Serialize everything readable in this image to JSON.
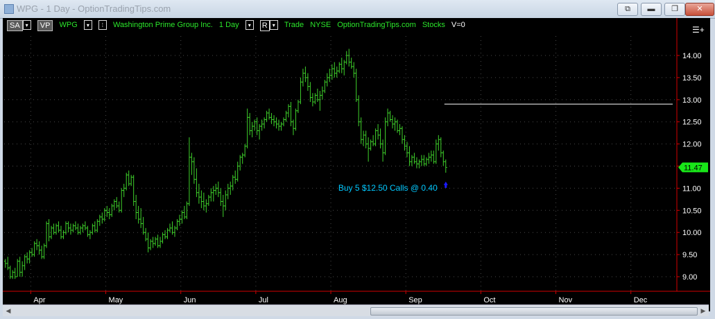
{
  "window": {
    "title": "WPG - 1 Day - OptionTradingTips.com",
    "buttons": {
      "pin": "⧉",
      "minimize": "▬",
      "restore": "❐",
      "close": "✕"
    }
  },
  "toolbar": {
    "sa": "SA",
    "vp": "VP",
    "symbol": "WPG",
    "company": "Washington Prime Group Inc.",
    "period": "1 Day",
    "r_box": "R",
    "type": "Trade",
    "exchange": "NYSE",
    "source": "OptionTradingTips.com",
    "asset": "Stocks",
    "volume": "V=0",
    "menu": "☰+"
  },
  "colors": {
    "bar": "#3fd22b",
    "axis": "#d40000",
    "price_tag": "#19e619",
    "annotation": "#00c8ff",
    "marker": "#1a1aff",
    "level": "#ffffff"
  },
  "chart_data": {
    "type": "bar",
    "subtype": "ohlc",
    "title": "",
    "xlabel": "",
    "ylabel": "",
    "ylim": [
      8.75,
      14.25
    ],
    "yticks": [
      "14.00",
      "13.50",
      "13.00",
      "12.50",
      "12.00",
      "11.50",
      "11.00",
      "10.50",
      "10.00",
      "9.50",
      "9.00"
    ],
    "month_labels": [
      "Apr",
      "May",
      "Jun",
      "Jul",
      "Aug",
      "Sep",
      "Oct",
      "Nov",
      "Dec"
    ],
    "month_start_index": [
      11,
      42,
      73,
      104,
      135,
      166,
      197,
      228,
      259
    ],
    "total_slots": 278,
    "last_price": "11.47",
    "level_line": 12.9,
    "annotation": "Buy 5 $12.50 Calls @ 0.40",
    "bars": [
      [
        9.35,
        9.4,
        9.2,
        9.3
      ],
      [
        9.3,
        9.45,
        9.15,
        9.2
      ],
      [
        9.2,
        9.25,
        8.95,
        9.0
      ],
      [
        9.0,
        9.15,
        8.95,
        9.1
      ],
      [
        9.1,
        9.2,
        8.95,
        9.0
      ],
      [
        9.0,
        9.4,
        9.0,
        9.35
      ],
      [
        9.35,
        9.45,
        9.0,
        9.1
      ],
      [
        9.1,
        9.35,
        9.0,
        9.25
      ],
      [
        9.25,
        9.5,
        9.15,
        9.45
      ],
      [
        9.45,
        9.55,
        9.3,
        9.4
      ],
      [
        9.4,
        9.6,
        9.3,
        9.55
      ],
      [
        9.55,
        9.65,
        9.45,
        9.5
      ],
      [
        9.5,
        9.8,
        9.45,
        9.75
      ],
      [
        9.75,
        9.85,
        9.6,
        9.7
      ],
      [
        9.7,
        9.8,
        9.5,
        9.6
      ],
      [
        9.6,
        9.7,
        9.4,
        9.45
      ],
      [
        9.45,
        9.75,
        9.4,
        9.7
      ],
      [
        9.7,
        10.25,
        9.65,
        10.2
      ],
      [
        10.2,
        10.3,
        9.8,
        9.9
      ],
      [
        9.9,
        10.15,
        9.85,
        10.1
      ],
      [
        10.1,
        10.2,
        9.95,
        10.0
      ],
      [
        10.0,
        10.2,
        9.95,
        10.15
      ],
      [
        10.15,
        10.25,
        10.0,
        10.05
      ],
      [
        10.05,
        10.15,
        9.85,
        9.9
      ],
      [
        9.9,
        10.05,
        9.85,
        10.0
      ],
      [
        10.0,
        10.25,
        9.95,
        10.2
      ],
      [
        10.2,
        10.25,
        10.0,
        10.1
      ],
      [
        10.1,
        10.2,
        9.95,
        10.05
      ],
      [
        10.05,
        10.2,
        10.0,
        10.15
      ],
      [
        10.15,
        10.25,
        10.05,
        10.1
      ],
      [
        10.1,
        10.2,
        9.95,
        10.0
      ],
      [
        10.0,
        10.15,
        9.95,
        10.1
      ],
      [
        10.1,
        10.2,
        10.0,
        10.15
      ],
      [
        10.15,
        10.25,
        10.05,
        10.1
      ],
      [
        10.1,
        10.15,
        9.9,
        9.95
      ],
      [
        9.95,
        10.05,
        9.85,
        10.0
      ],
      [
        10.0,
        10.2,
        9.95,
        10.15
      ],
      [
        10.15,
        10.25,
        10.0,
        10.05
      ],
      [
        10.05,
        10.3,
        10.0,
        10.25
      ],
      [
        10.25,
        10.4,
        10.15,
        10.35
      ],
      [
        10.35,
        10.45,
        10.2,
        10.3
      ],
      [
        10.3,
        10.55,
        10.25,
        10.5
      ],
      [
        10.5,
        10.6,
        10.35,
        10.45
      ],
      [
        10.45,
        10.55,
        10.3,
        10.4
      ],
      [
        10.4,
        10.65,
        10.35,
        10.6
      ],
      [
        10.6,
        10.75,
        10.5,
        10.7
      ],
      [
        10.7,
        10.8,
        10.55,
        10.6
      ],
      [
        10.6,
        10.7,
        10.45,
        10.5
      ],
      [
        10.5,
        11.0,
        10.45,
        10.95
      ],
      [
        10.95,
        11.1,
        10.8,
        11.0
      ],
      [
        11.0,
        11.35,
        10.95,
        11.3
      ],
      [
        11.3,
        11.4,
        11.05,
        11.1
      ],
      [
        11.1,
        11.3,
        11.05,
        11.25
      ],
      [
        11.25,
        11.3,
        10.6,
        10.7
      ],
      [
        10.7,
        10.85,
        10.3,
        10.45
      ],
      [
        10.45,
        10.6,
        10.2,
        10.3
      ],
      [
        10.3,
        10.55,
        10.1,
        10.2
      ],
      [
        10.2,
        10.35,
        9.95,
        10.0
      ],
      [
        10.0,
        10.1,
        9.8,
        9.85
      ],
      [
        9.85,
        10.0,
        9.55,
        9.65
      ],
      [
        9.65,
        9.85,
        9.6,
        9.8
      ],
      [
        9.8,
        9.9,
        9.65,
        9.75
      ],
      [
        9.75,
        9.9,
        9.7,
        9.85
      ],
      [
        9.85,
        9.95,
        9.65,
        9.7
      ],
      [
        9.7,
        9.9,
        9.65,
        9.8
      ],
      [
        9.8,
        10.0,
        9.75,
        9.95
      ],
      [
        9.95,
        10.05,
        9.85,
        9.9
      ],
      [
        9.9,
        10.1,
        9.85,
        10.05
      ],
      [
        10.05,
        10.2,
        10.0,
        10.1
      ],
      [
        10.1,
        10.25,
        9.95,
        10.0
      ],
      [
        10.0,
        10.15,
        9.9,
        10.1
      ],
      [
        10.1,
        10.3,
        10.05,
        10.25
      ],
      [
        10.25,
        10.4,
        10.15,
        10.3
      ],
      [
        10.3,
        10.5,
        10.2,
        10.45
      ],
      [
        10.45,
        10.6,
        10.3,
        10.35
      ],
      [
        10.35,
        10.7,
        10.3,
        10.65
      ],
      [
        10.65,
        12.15,
        10.6,
        11.7
      ],
      [
        11.7,
        11.8,
        11.3,
        11.6
      ],
      [
        11.6,
        11.7,
        11.1,
        11.2
      ],
      [
        11.2,
        11.45,
        10.8,
        10.9
      ],
      [
        10.9,
        11.1,
        10.65,
        10.8
      ],
      [
        10.8,
        10.95,
        10.55,
        10.7
      ],
      [
        10.7,
        10.9,
        10.5,
        10.6
      ],
      [
        10.6,
        10.75,
        10.45,
        10.65
      ],
      [
        10.65,
        10.85,
        10.6,
        10.8
      ],
      [
        10.8,
        11.0,
        10.7,
        10.9
      ],
      [
        10.9,
        11.05,
        10.7,
        10.95
      ],
      [
        10.95,
        11.1,
        10.85,
        11.0
      ],
      [
        11.0,
        11.15,
        10.8,
        10.9
      ],
      [
        10.9,
        11.0,
        10.6,
        10.7
      ],
      [
        10.7,
        10.85,
        10.35,
        10.6
      ],
      [
        10.6,
        10.95,
        10.5,
        10.85
      ],
      [
        10.85,
        11.1,
        10.75,
        11.0
      ],
      [
        11.0,
        11.15,
        10.85,
        11.05
      ],
      [
        11.05,
        11.3,
        10.95,
        11.25
      ],
      [
        11.25,
        11.4,
        11.1,
        11.2
      ],
      [
        11.2,
        11.6,
        11.15,
        11.5
      ],
      [
        11.5,
        11.75,
        11.4,
        11.7
      ],
      [
        11.7,
        11.8,
        11.55,
        11.75
      ],
      [
        11.75,
        12.0,
        11.7,
        11.95
      ],
      [
        11.95,
        12.8,
        11.9,
        12.6
      ],
      [
        12.6,
        12.7,
        12.2,
        12.3
      ],
      [
        12.3,
        12.5,
        12.15,
        12.4
      ],
      [
        12.4,
        12.55,
        12.3,
        12.5
      ],
      [
        12.5,
        12.6,
        12.2,
        12.3
      ],
      [
        12.3,
        12.45,
        12.1,
        12.4
      ],
      [
        12.4,
        12.55,
        12.3,
        12.45
      ],
      [
        12.45,
        12.6,
        12.35,
        12.55
      ],
      [
        12.55,
        12.75,
        12.5,
        12.7
      ],
      [
        12.7,
        12.8,
        12.55,
        12.6
      ],
      [
        12.6,
        12.7,
        12.45,
        12.55
      ],
      [
        12.55,
        12.65,
        12.4,
        12.5
      ],
      [
        12.5,
        12.6,
        12.35,
        12.45
      ],
      [
        12.45,
        12.55,
        12.3,
        12.4
      ],
      [
        12.4,
        12.5,
        12.3,
        12.45
      ],
      [
        12.45,
        12.6,
        12.4,
        12.55
      ],
      [
        12.55,
        12.75,
        12.5,
        12.7
      ],
      [
        12.7,
        12.9,
        12.6,
        12.85
      ],
      [
        12.85,
        12.95,
        12.4,
        12.5
      ],
      [
        12.5,
        12.55,
        12.2,
        12.35
      ],
      [
        12.35,
        12.8,
        12.3,
        12.75
      ],
      [
        12.75,
        13.0,
        12.7,
        12.95
      ],
      [
        12.95,
        13.5,
        12.9,
        13.4
      ],
      [
        13.4,
        13.7,
        13.3,
        13.6
      ],
      [
        13.6,
        13.75,
        13.4,
        13.5
      ],
      [
        13.5,
        13.6,
        13.2,
        13.3
      ],
      [
        13.3,
        13.4,
        12.95,
        13.05
      ],
      [
        13.05,
        13.15,
        12.85,
        12.95
      ],
      [
        12.95,
        13.15,
        12.9,
        13.1
      ],
      [
        13.1,
        13.25,
        12.95,
        13.0
      ],
      [
        13.0,
        13.2,
        12.75,
        13.1
      ],
      [
        13.1,
        13.3,
        13.0,
        13.2
      ],
      [
        13.2,
        13.45,
        13.15,
        13.4
      ],
      [
        13.4,
        13.6,
        13.3,
        13.5
      ],
      [
        13.5,
        13.7,
        13.4,
        13.55
      ],
      [
        13.55,
        13.8,
        13.45,
        13.7
      ],
      [
        13.7,
        13.85,
        13.5,
        13.6
      ],
      [
        13.6,
        13.75,
        13.5,
        13.65
      ],
      [
        13.65,
        13.85,
        13.6,
        13.8
      ],
      [
        13.8,
        13.95,
        13.6,
        13.7
      ],
      [
        13.7,
        13.9,
        13.55,
        13.85
      ],
      [
        13.85,
        14.1,
        13.8,
        14.0
      ],
      [
        14.0,
        14.15,
        13.75,
        13.85
      ],
      [
        13.85,
        13.95,
        13.7,
        13.75
      ],
      [
        13.75,
        13.85,
        13.5,
        13.6
      ],
      [
        13.6,
        13.7,
        12.95,
        13.0
      ],
      [
        13.0,
        13.1,
        12.4,
        12.5
      ],
      [
        12.5,
        12.6,
        12.0,
        12.1
      ],
      [
        12.1,
        12.3,
        11.95,
        12.2
      ],
      [
        12.2,
        12.3,
        11.9,
        12.0
      ],
      [
        12.0,
        12.15,
        11.6,
        11.9
      ],
      [
        11.9,
        12.1,
        11.85,
        12.05
      ],
      [
        12.05,
        12.2,
        11.95,
        12.0
      ],
      [
        12.0,
        12.35,
        11.95,
        12.3
      ],
      [
        12.3,
        12.45,
        12.1,
        12.2
      ],
      [
        12.2,
        12.35,
        11.9,
        12.0
      ],
      [
        12.0,
        12.1,
        11.6,
        11.8
      ],
      [
        11.8,
        12.6,
        11.75,
        12.5
      ],
      [
        12.5,
        12.8,
        12.4,
        12.7
      ],
      [
        12.7,
        12.75,
        12.5,
        12.55
      ],
      [
        12.55,
        12.65,
        12.35,
        12.45
      ],
      [
        12.45,
        12.6,
        12.3,
        12.5
      ],
      [
        12.5,
        12.55,
        12.25,
        12.3
      ],
      [
        12.3,
        12.45,
        12.2,
        12.35
      ],
      [
        12.35,
        12.4,
        12.0,
        12.1
      ],
      [
        12.1,
        12.2,
        11.85,
        11.95
      ],
      [
        11.95,
        12.05,
        11.7,
        11.8
      ],
      [
        11.8,
        11.95,
        11.5,
        11.6
      ],
      [
        11.6,
        11.75,
        11.5,
        11.7
      ],
      [
        11.7,
        11.8,
        11.55,
        11.6
      ],
      [
        11.6,
        11.7,
        11.45,
        11.55
      ],
      [
        11.55,
        11.65,
        11.45,
        11.6
      ],
      [
        11.6,
        11.75,
        11.5,
        11.65
      ],
      [
        11.65,
        11.75,
        11.5,
        11.55
      ],
      [
        11.55,
        11.7,
        11.5,
        11.65
      ],
      [
        11.65,
        11.8,
        11.55,
        11.7
      ],
      [
        11.7,
        11.85,
        11.6,
        11.75
      ],
      [
        11.75,
        11.85,
        11.55,
        11.6
      ],
      [
        11.6,
        12.1,
        11.55,
        12.0
      ],
      [
        12.0,
        12.2,
        11.85,
        12.1
      ],
      [
        12.1,
        12.15,
        11.7,
        11.8
      ],
      [
        11.8,
        11.85,
        11.5,
        11.6
      ],
      [
        11.6,
        11.65,
        11.35,
        11.47
      ]
    ]
  }
}
